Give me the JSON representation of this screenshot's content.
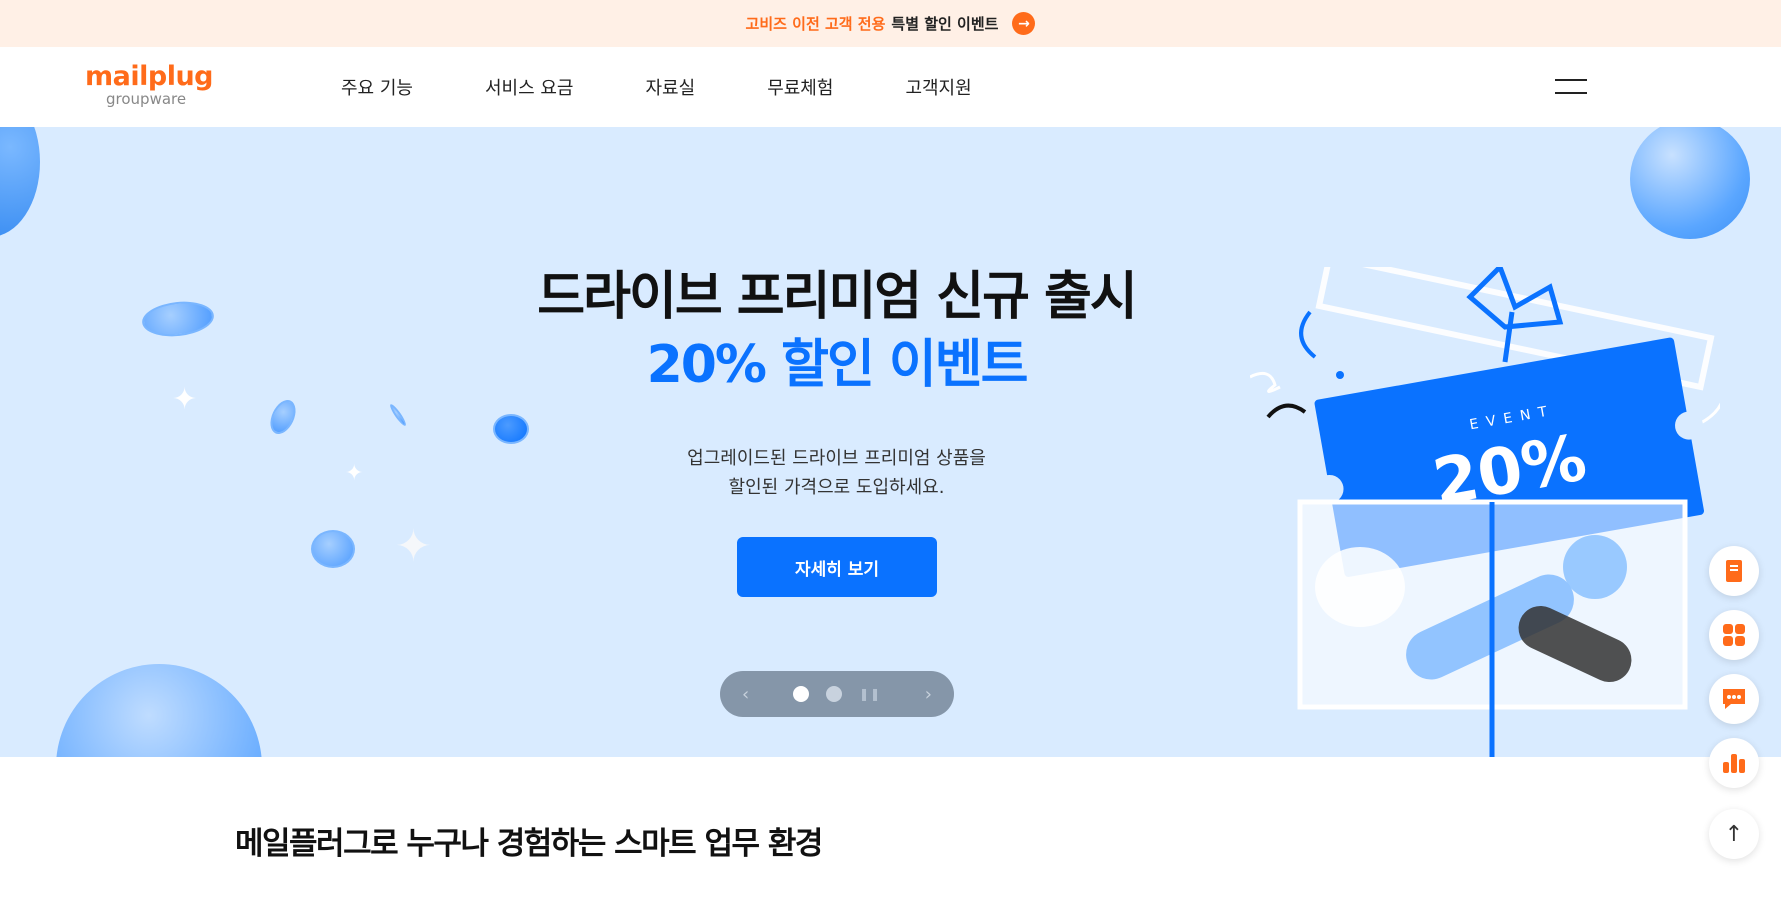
{
  "topbar": {
    "highlight": "고비즈 이전 고객 전용",
    "text": "특별 할인 이벤트",
    "arrow_icon": "arrow-right-icon",
    "bg_color": "#fff0e6",
    "accent_color": "#ff6b1a"
  },
  "header": {
    "logo_main": "mailplug",
    "logo_sub": "groupware",
    "nav": [
      "주요 기능",
      "서비스 요금",
      "자료실",
      "무료체험",
      "고객지원"
    ],
    "menu_icon": "hamburger-icon"
  },
  "hero": {
    "title_line1": "드라이브 프리미엄 신규 출시",
    "title_line2": "20% 할인 이벤트",
    "desc_line1": "업그레이드된 드라이브 프리미엄 상품을",
    "desc_line2": "할인된 가격으로 도입하세요.",
    "cta_label": "자세히 보기",
    "ticket_event": "EVENT",
    "ticket_percent": "20%",
    "bg_color": "#d9ebff",
    "brand_blue": "#0a72ff",
    "pager": {
      "prev_icon": "chevron-left-icon",
      "next_icon": "chevron-right-icon",
      "pause_icon": "pause-icon",
      "slides": 2,
      "active": 1
    }
  },
  "floating_menu": [
    "book-icon",
    "apps-icon",
    "chat-icon",
    "chart-icon",
    "arrow-up-icon"
  ],
  "section": {
    "title": "메일플러그로 누구나 경험하는 스마트 업무 환경"
  }
}
